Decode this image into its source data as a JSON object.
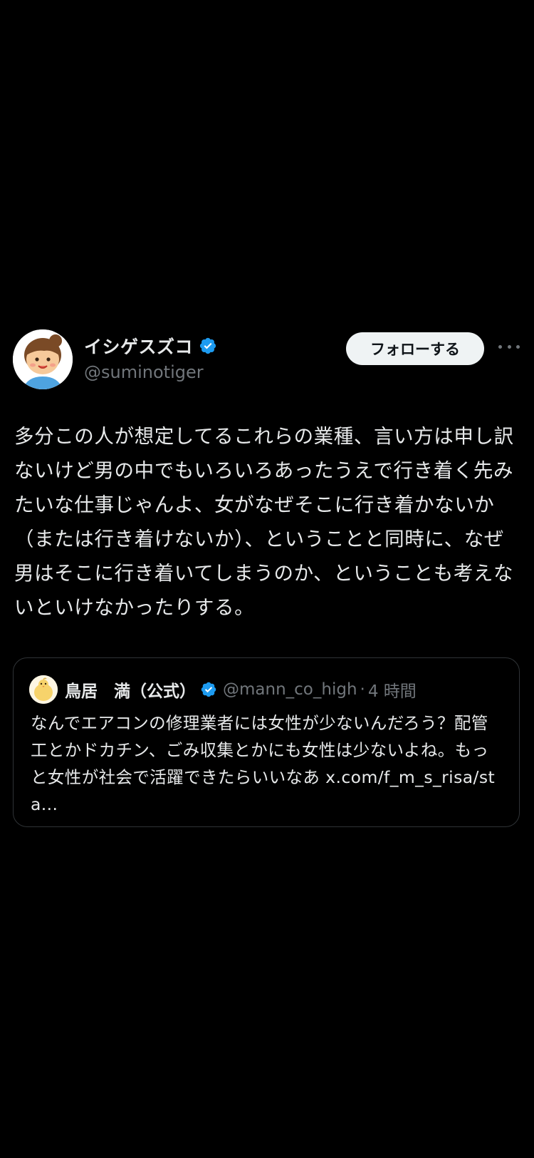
{
  "colors": {
    "background": "#000000",
    "text_primary": "#e7e9ea",
    "text_secondary": "#71767b",
    "verified_blue": "#1d9bf0",
    "follow_button_bg": "#eff3f4",
    "border": "#2f3336"
  },
  "tweet": {
    "author": {
      "display_name": "イシゲスズコ",
      "handle": "@suminotiger",
      "avatar_icon": "cartoon-girl-avatar",
      "verified_icon": "verified-badge-icon"
    },
    "follow_label": "フォローする",
    "more_icon": "more-options-icon",
    "text": "多分この人が想定してるこれらの業種、言い方は申し訳ないけど男の中でもいろいろあったうえで行き着く先みたいな仕事じゃんよ、女がなぜそこに行き着かないか（または行き着けないか）、ということと同時に、なぜ男はそこに行き着いてしまうのか、ということも考えないといけなかったりする。"
  },
  "quote": {
    "author": {
      "display_name": "鳥居　満（公式）",
      "handle": "@mann_co_high",
      "avatar_icon": "chick-avatar",
      "verified_icon": "verified-badge-icon"
    },
    "separator": "·",
    "time": "4 時間",
    "text": "なんでエアコンの修理業者には女性が少ないんだろう？配管工とかドカチン、ごみ収集とかにも女性は少ないよね。もっと女性が社会で活躍できたらいいなあ x.com/f_m_s_risa/sta..."
  }
}
